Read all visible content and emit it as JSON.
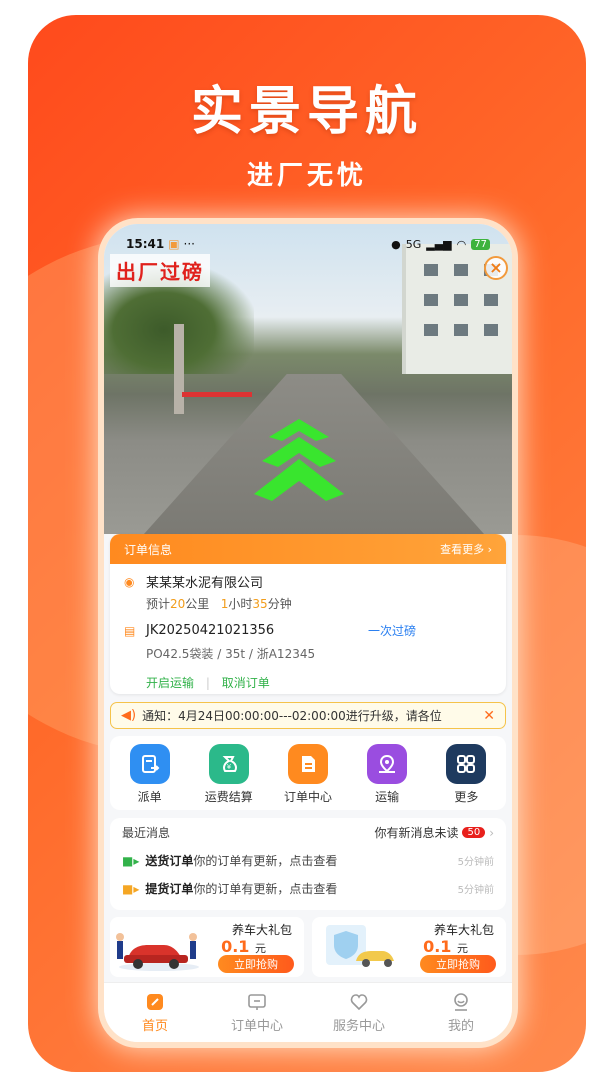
{
  "poster": {
    "headline": "实景导航",
    "subline": "进厂无忧"
  },
  "status_bar": {
    "time": "15:41",
    "signal": "5G",
    "battery": "77"
  },
  "street_view": {
    "label": "出厂过磅",
    "close_label": "×"
  },
  "order": {
    "header_title": "订单信息",
    "header_more": "查看更多 ›",
    "company": "某某某水泥有限公司",
    "eta_prefix": "预计",
    "eta_distance": "20",
    "eta_distance_unit": "公里",
    "eta_hours": "1",
    "eta_hours_unit": "小时",
    "eta_minutes": "35",
    "eta_minutes_unit": "分钟",
    "order_no": "JK20250421021356",
    "weigh_status": "一次过磅",
    "spec": "PO42.5袋装  /    35t    /    浙A12345",
    "start_transport": "开启运输",
    "cancel_order": "取消订单"
  },
  "notice": {
    "text": "通知：4月24日00:00:00---02:00:00进行升级，请各位"
  },
  "menu": [
    {
      "label": "派单",
      "color": "#2f8ff2"
    },
    {
      "label": "运费结算",
      "color": "#2bb98a"
    },
    {
      "label": "订单中心",
      "color": "#ff8a1f"
    },
    {
      "label": "运输",
      "color": "#9a4de0"
    },
    {
      "label": "更多",
      "color": "#1e3a5f"
    }
  ],
  "messages": {
    "title": "最近消息",
    "unread_text": "你有新消息未读",
    "unread_count": "50",
    "items": [
      {
        "bold": "送货订单",
        "text": "你的订单有更新，点击查看",
        "time": "5分钟前",
        "color": "#32b24a"
      },
      {
        "bold": "提货订单",
        "text": "你的订单有更新，点击查看",
        "time": "5分钟前",
        "color": "#f5a623"
      }
    ]
  },
  "promos": [
    {
      "title": "养车大礼包",
      "price": "0.1",
      "unit": "元",
      "button": "立即抢购"
    },
    {
      "title": "养车大礼包",
      "price": "0.1",
      "unit": "元",
      "button": "立即抢购"
    }
  ],
  "tabs": [
    {
      "label": "首页"
    },
    {
      "label": "订单中心"
    },
    {
      "label": "服务中心"
    },
    {
      "label": "我的"
    }
  ],
  "colors": {
    "accent": "#ff8a1f",
    "poster_bg": "#ff5a22"
  }
}
